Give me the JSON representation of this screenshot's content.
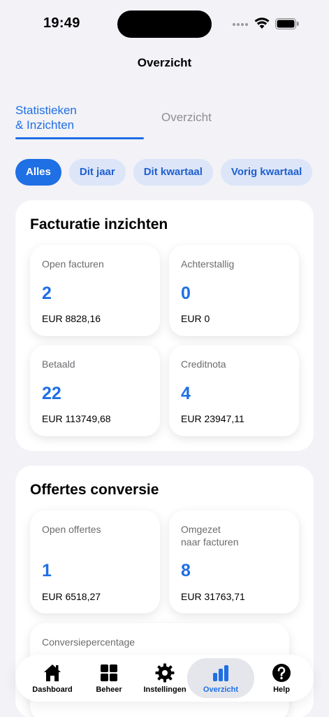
{
  "status_bar": {
    "time": "19:49"
  },
  "nav": {
    "title": "Overzicht"
  },
  "tabs": [
    {
      "label": "Statistieken\n& Inzichten",
      "line1": "Statistieken",
      "line2": "& Inzichten"
    },
    {
      "label": "Overzicht"
    }
  ],
  "filters": [
    "Alles",
    "Dit jaar",
    "Dit kwartaal",
    "Vorig kwartaal"
  ],
  "invoicing": {
    "title": "Facturatie inzichten",
    "cards": [
      {
        "label": "Open facturen",
        "value": "2",
        "amount": "EUR 8828,16"
      },
      {
        "label": "Achterstallig",
        "value": "0",
        "amount": "EUR 0"
      },
      {
        "label": "Betaald",
        "value": "22",
        "amount": "EUR 113749,68"
      },
      {
        "label": "Creditnota",
        "value": "4",
        "amount": "EUR 23947,11"
      }
    ]
  },
  "quotes": {
    "title": "Offertes conversie",
    "cards": [
      {
        "label": "Open offertes",
        "value": "1",
        "amount": "EUR 6518,27"
      },
      {
        "label_line1": "Omgezet",
        "label_line2": "naar facturen",
        "value": "8",
        "amount": "EUR 31763,71"
      }
    ],
    "conversion_label": "Conversiepercentage"
  },
  "tabbar": [
    {
      "label": "Dashboard",
      "icon": "house-icon"
    },
    {
      "label": "Beheer",
      "icon": "grid-icon"
    },
    {
      "label": "Instellingen",
      "icon": "gear-icon"
    },
    {
      "label": "Overzicht",
      "icon": "bar-chart-icon"
    },
    {
      "label": "Help",
      "icon": "question-icon"
    }
  ],
  "colors": {
    "accent": "#1F6FE5",
    "chip_bg": "#DCE6F8",
    "background": "#F2F2F7"
  }
}
